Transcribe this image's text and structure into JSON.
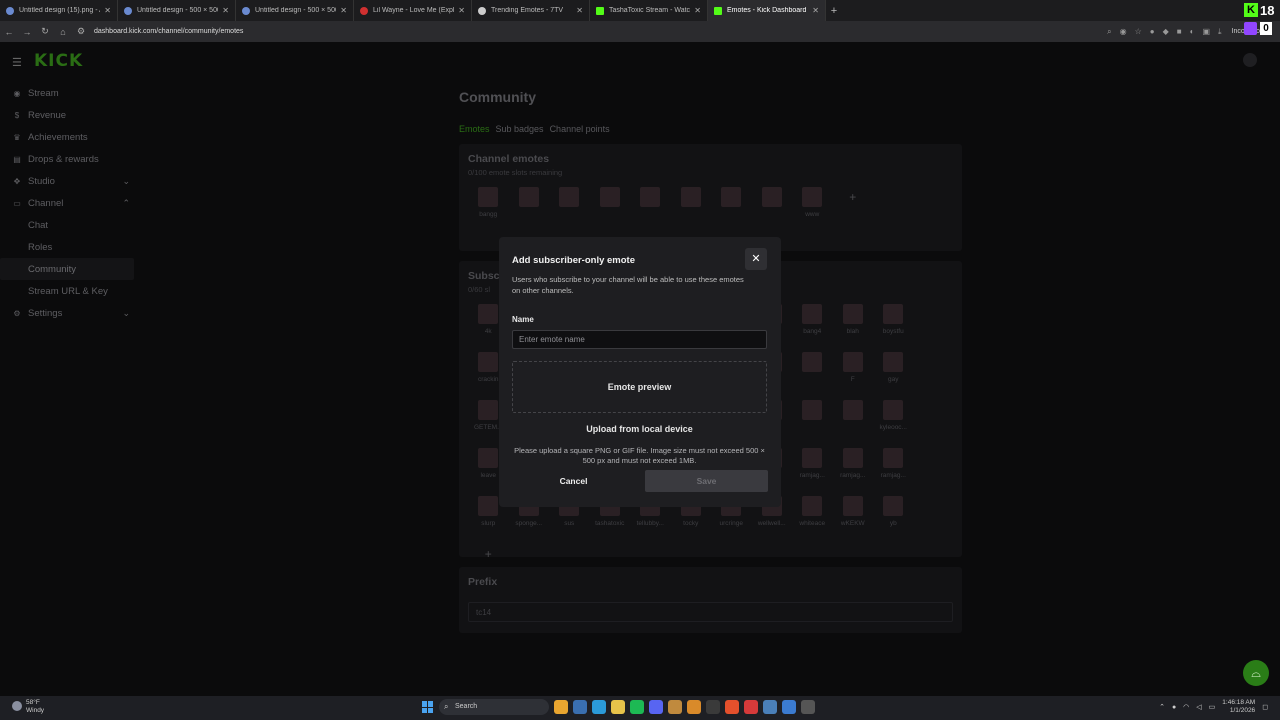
{
  "browser": {
    "tabs": [
      {
        "title": "Untitled design (15).png - Ani"
      },
      {
        "title": "Untitled design - 500 × 500px"
      },
      {
        "title": "Untitled design - 500 × 500px"
      },
      {
        "title": "Lil Wayne - Love Me (Expli"
      },
      {
        "title": "Trending Emotes - 7TV"
      },
      {
        "title": "TashaToxic Stream - Watch Liv"
      },
      {
        "title": "Emotes - Kick Dashboard"
      }
    ],
    "url": "dashboard.kick.com/channel/community/emotes",
    "incognito_label": "Incognito",
    "kick_count": "18",
    "twitch_count": "0"
  },
  "app": {
    "logo": "KICK",
    "sidebar": [
      {
        "label": "Stream",
        "icon": "stream-icon"
      },
      {
        "label": "Revenue",
        "icon": "dollar-icon"
      },
      {
        "label": "Achievements",
        "icon": "trophy-icon"
      },
      {
        "label": "Drops & rewards",
        "icon": "gift-icon"
      },
      {
        "label": "Studio",
        "icon": "studio-icon"
      },
      {
        "label": "Channel",
        "icon": "channel-icon"
      },
      {
        "label": "Chat"
      },
      {
        "label": "Roles"
      },
      {
        "label": "Community"
      },
      {
        "label": "Stream URL & Key"
      },
      {
        "label": "Settings",
        "icon": "gear-icon"
      }
    ],
    "page_title": "Community",
    "tabs": [
      "Emotes",
      "Sub badges",
      "Channel points"
    ],
    "channel_emotes": {
      "title": "Channel emotes",
      "subtitle": "0/100 emote slots remaining",
      "names": [
        "bangg",
        "",
        "",
        "",
        "",
        "",
        "",
        "",
        "www"
      ]
    },
    "sub_emotes": {
      "title": "Subsc",
      "subtitle": "0/60 sl",
      "rows": [
        [
          "4k",
          "",
          "",
          "",
          "",
          "",
          "",
          "",
          "bang4",
          "blah",
          "boystfu",
          "crackin"
        ],
        [
          "cuffedb...",
          "",
          "",
          "",
          "",
          "",
          "",
          "",
          "F",
          "gay",
          "GETEM...",
          "getton"
        ],
        [
          "GetOut",
          "",
          "",
          "",
          "",
          "",
          "",
          "",
          "kyleooc...",
          "leave",
          "lush",
          "maracas"
        ],
        [
          "merchant",
          "micsmal",
          "ml",
          "pranam...",
          "punk",
          "ramjag...",
          "ramjag...",
          "ramjag...",
          "slurp",
          "sponge...",
          "sus",
          "tashatoxic"
        ],
        [
          "tellubby...",
          "tocky",
          "urcringe",
          "wellwell...",
          "whiteace",
          "wKEKW",
          "yb"
        ]
      ]
    },
    "prefix": {
      "title": "Prefix",
      "value": "tc14"
    }
  },
  "modal": {
    "title": "Add subscriber-only emote",
    "description": "Users who subscribe to your channel will be able to use these emotes on other channels.",
    "name_label": "Name",
    "name_placeholder": "Enter emote name",
    "preview_label": "Emote preview",
    "upload_label": "Upload from local device",
    "hint": "Please upload a square PNG or GIF file. Image size must not exceed 500 × 500 px and must not exceed 1MB.",
    "cancel_label": "Cancel",
    "save_label": "Save"
  },
  "taskbar": {
    "weather_temp": "58°F",
    "weather_desc": "Windy",
    "search_label": "Search",
    "time": "1:46:18 AM",
    "date": "1/1/2026"
  },
  "colors": {
    "accent": "#53fc18",
    "modal_bg": "#1e1e21"
  }
}
